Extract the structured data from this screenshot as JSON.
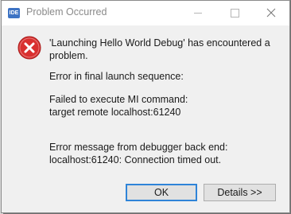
{
  "window": {
    "title": "Problem Occurred",
    "app_icon_label": "IDE"
  },
  "controls": {
    "minimize": "minimize-icon",
    "maximize": "maximize-icon",
    "close": "close-icon"
  },
  "message": {
    "headline_line1": "'Launching Hello World Debug' has encountered a",
    "headline_line2": "problem.",
    "error_line": "Error in final launch sequence:",
    "failed_line1": "Failed to execute MI command:",
    "failed_line2": "target remote localhost:61240",
    "debugger_line1": "Error message from debugger back end:",
    "debugger_line2": "localhost:61240: Connection timed out."
  },
  "buttons": {
    "ok": "OK",
    "details": "Details >>"
  },
  "colors": {
    "error_red": "#d9302f",
    "focus_blue": "#2f84d8",
    "app_icon_blue": "#3d73c4"
  }
}
